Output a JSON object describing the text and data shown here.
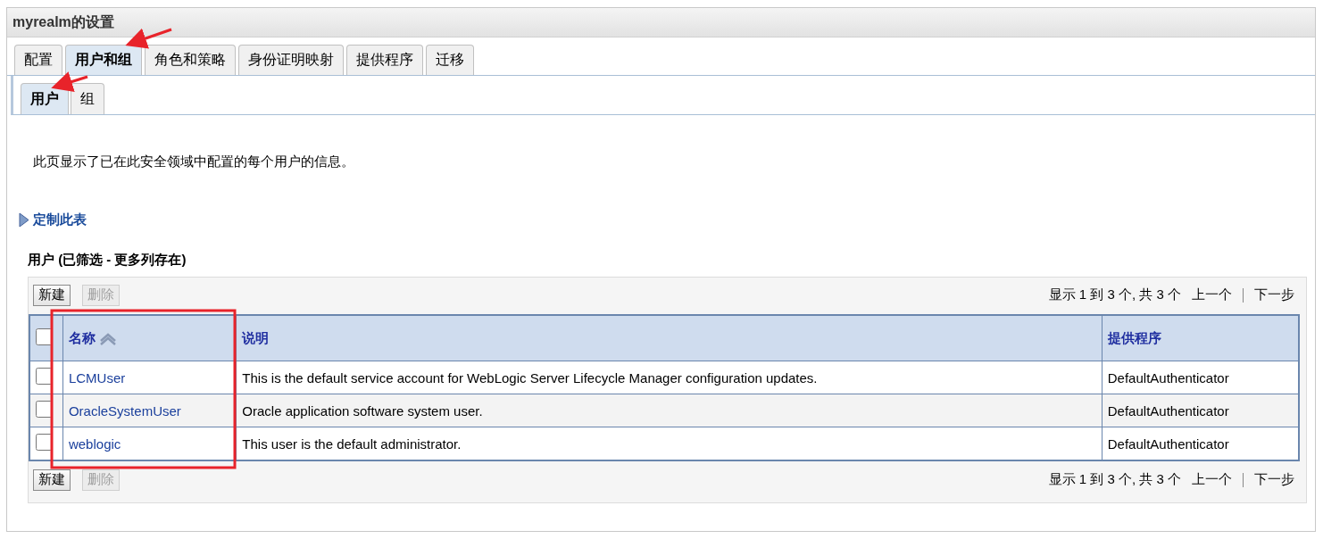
{
  "window": {
    "title": "myrealm的设置"
  },
  "tabs": [
    {
      "label": "配置",
      "selected": false
    },
    {
      "label": "用户和组",
      "selected": true
    },
    {
      "label": "角色和策略",
      "selected": false
    },
    {
      "label": "身份证明映射",
      "selected": false
    },
    {
      "label": "提供程序",
      "selected": false
    },
    {
      "label": "迁移",
      "selected": false
    }
  ],
  "subtabs": [
    {
      "label": "用户",
      "selected": true
    },
    {
      "label": "组",
      "selected": false
    }
  ],
  "description": "此页显示了已在此安全领域中配置的每个用户的信息。",
  "customize_link": {
    "label": "定制此表",
    "expanded": false
  },
  "table": {
    "caption": "用户 (已筛选 - 更多列存在)",
    "top_buttons": [
      {
        "label": "新建",
        "disabled": false
      },
      {
        "label": "删除",
        "disabled": true
      }
    ],
    "bottom_buttons": [
      {
        "label": "新建",
        "disabled": false
      },
      {
        "label": "删除",
        "disabled": true
      }
    ],
    "paging_top": {
      "summary": "显示 1 到 3 个, 共 3 个",
      "previous": "上一个",
      "next": "下一步"
    },
    "paging_bottom": {
      "summary": "显示 1 到 3 个, 共 3 个",
      "previous": "上一个",
      "next": "下一步"
    },
    "select_all_checked": false,
    "columns": [
      {
        "label": "名称",
        "sorted": true
      },
      {
        "label": "说明",
        "sorted": false
      },
      {
        "label": "提供程序",
        "sorted": false
      }
    ],
    "rows": [
      {
        "checked": false,
        "name": "LCMUser",
        "description": "This is the default service account for WebLogic Server Lifecycle Manager configuration updates.",
        "provider": "DefaultAuthenticator"
      },
      {
        "checked": false,
        "name": "OracleSystemUser",
        "description": "Oracle application software system user.",
        "provider": "DefaultAuthenticator"
      },
      {
        "checked": false,
        "name": "weblogic",
        "description": "This user is the default administrator.",
        "provider": "DefaultAuthenticator"
      }
    ]
  }
}
